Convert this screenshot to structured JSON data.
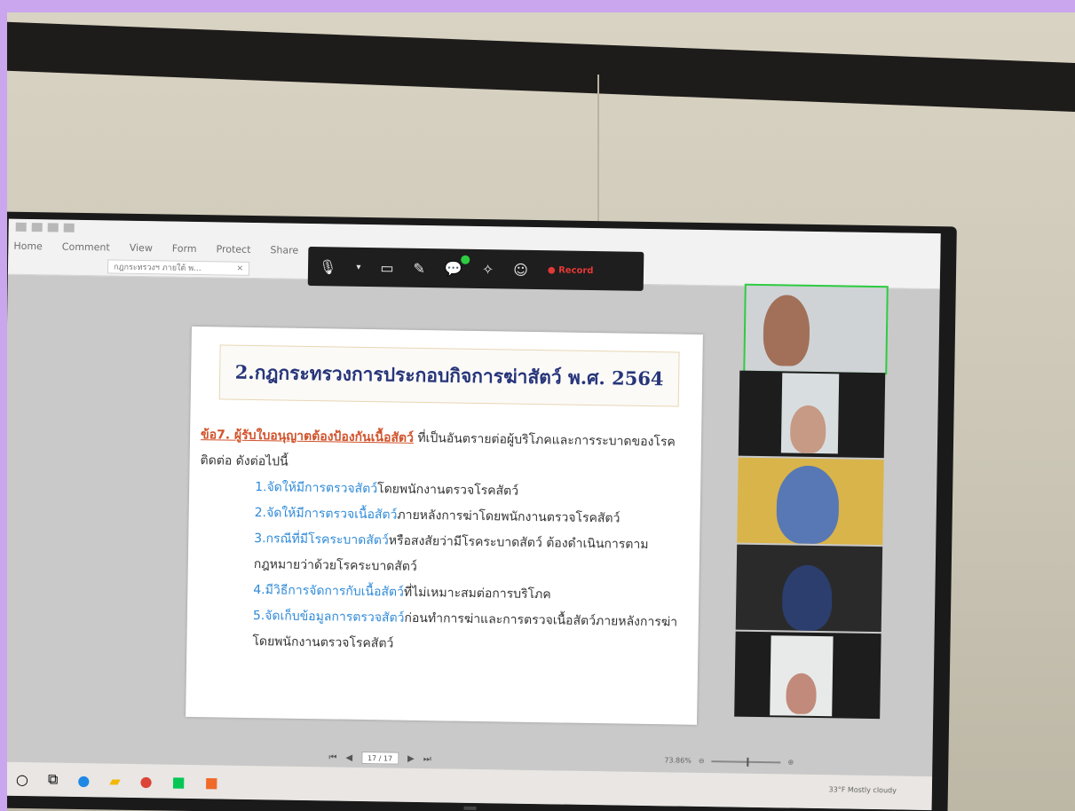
{
  "slide": {
    "title": "2.กฎกระทรวงการประกอบกิจการฆ่าสัตว์ พ.ศ. 2564",
    "clause_lead": "ข้อ7. ผู้รับใบอนุญาตต้องป้องกันเนื้อสัตว์",
    "clause_rest": " ที่เป็นอันตรายต่อผู้บริโภคและการระบาดของโรคติดต่อ ดังต่อไปนี้",
    "items": [
      {
        "hl": "1.จัดให้มีการตรวจสัตว์",
        "rest": "โดยพนักงานตรวจโรคสัตว์"
      },
      {
        "hl": "2.จัดให้มีการตรวจเนื้อสัตว์",
        "rest": "ภายหลังการฆ่าโดยพนักงานตรวจโรคสัตว์"
      },
      {
        "hl": "3.กรณีที่มีโรคระบาดสัตว์",
        "rest": "หรือสงสัยว่ามีโรคระบาดสัตว์ ต้องดำเนินการตามกฎหมายว่าด้วยโรคระบาดสัตว์"
      },
      {
        "hl": "4.มีวิธีการจัดการกับเนื้อสัตว์",
        "rest": "ที่ไม่เหมาะสมต่อการบริโภค"
      },
      {
        "hl": "5.จัดเก็บข้อมูลการตรวจสัตว์",
        "rest": "ก่อนทำการฆ่าและการตรวจเนื้อสัตว์ภายหลังการฆ่า โดยพนักงานตรวจโรคสัตว์"
      }
    ]
  },
  "ribbon": {
    "menus": [
      "Home",
      "Comment",
      "View",
      "Form",
      "Protect",
      "Share"
    ],
    "doc_tab": "กฎกระทรวงฯ ภายใต้ พ...",
    "doc_tab_close": "×"
  },
  "meeting": {
    "record": "● Record"
  },
  "nav": {
    "page": "17 / 17"
  },
  "zoom": {
    "level": "73.86%"
  },
  "tray": {
    "weather": "33°F  Mostly cloudy"
  }
}
